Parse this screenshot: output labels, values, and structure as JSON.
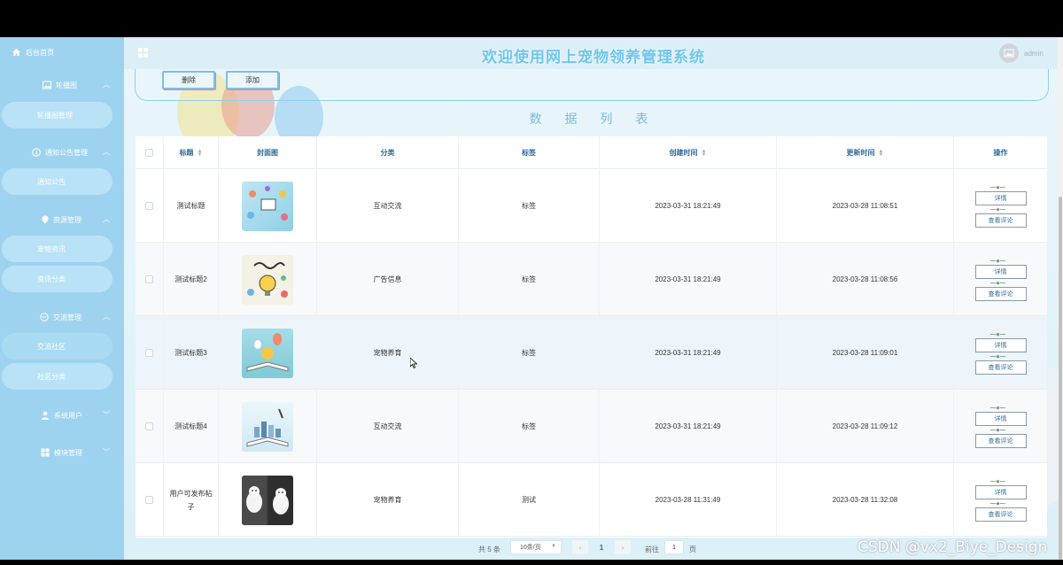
{
  "header": {
    "title": "欢迎使用网上宠物领养管理系统",
    "user": "admin"
  },
  "sidebar": {
    "home": "后台首页",
    "groups": [
      {
        "label": "轮播图",
        "icon": "image-icon",
        "items": [
          "轮播图管理"
        ]
      },
      {
        "label": "通知公告管理",
        "icon": "info-circle-icon",
        "items": [
          "通知公告"
        ]
      },
      {
        "label": "资源管理",
        "icon": "location-pin-icon",
        "items": [
          "宠物资讯",
          "资讯分类"
        ]
      },
      {
        "label": "交流管理",
        "icon": "chat-icon",
        "items": [
          "交流社区",
          "社区分类"
        ]
      },
      {
        "label": "系统用户",
        "icon": "user-icon",
        "items": []
      },
      {
        "label": "模块管理",
        "icon": "grid-icon",
        "items": []
      }
    ]
  },
  "toolbar": {
    "delete_label": "删除",
    "add_label": "添加"
  },
  "list_title": "数 据 列 表",
  "table": {
    "columns": [
      "标题",
      "封面图",
      "分类",
      "标签",
      "创建时间",
      "更新时间",
      "操作"
    ],
    "rows": [
      {
        "title": "测试标题",
        "category": "互动交流",
        "tag": "标签",
        "created": "2023-03-31 18:21:49",
        "updated": "2023-03-28 11:08:51"
      },
      {
        "title": "测试标题2",
        "category": "广告信息",
        "tag": "标签",
        "created": "2023-03-31 18:21:49",
        "updated": "2023-03-28 11:08:56"
      },
      {
        "title": "测试标题3",
        "category": "宠物养育",
        "tag": "标签",
        "created": "2023-03-31 18:21:49",
        "updated": "2023-03-28 11:09:01"
      },
      {
        "title": "测试标题4",
        "category": "互动交流",
        "tag": "标签",
        "created": "2023-03-31 18:21:49",
        "updated": "2023-03-28 11:09:12"
      },
      {
        "title": "用户可发布帖子",
        "category": "宠物养育",
        "tag": "测试",
        "created": "2023-03-28 11:31:49",
        "updated": "2023-03-28 11:32:08"
      }
    ],
    "ops": {
      "detail": "详情",
      "comments": "查看评论"
    }
  },
  "pagination": {
    "total": "共 5 条",
    "page_size": "10条/页",
    "current": "1",
    "goto_label": "前往",
    "goto_value": "1",
    "page_label": "页",
    "prev": "‹",
    "next": "›"
  },
  "watermark": "CSDN @vx2_Biye_Design",
  "colors": {
    "sidebar": "#9ed3f0",
    "title": "#6ec6ee",
    "header_text": "#2f6b9a"
  }
}
